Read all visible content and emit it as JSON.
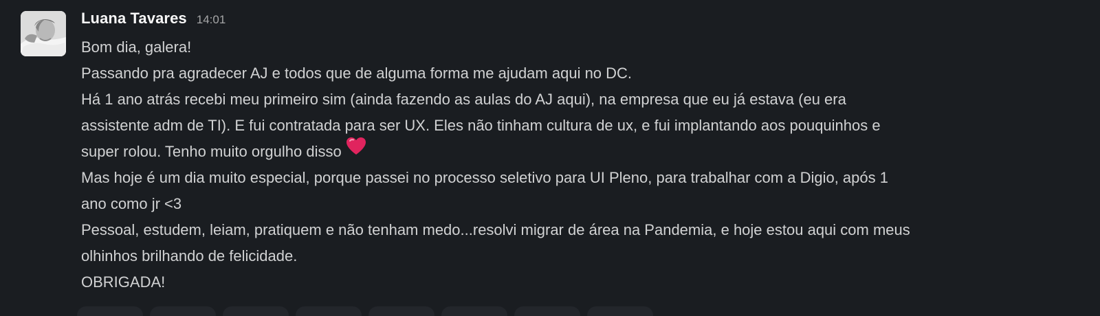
{
  "message": {
    "author": "Luana Tavares",
    "timestamp": "14:01",
    "avatar_icon": "user-avatar-photo",
    "lines": {
      "l1": "Bom dia, galera!",
      "l2": "Passando pra agradecer AJ e todos que de alguma forma me ajudam aqui no DC.",
      "l3": "Há 1 ano atrás recebi meu primeiro sim (ainda fazendo as aulas do AJ aqui), na empresa que eu já estava (eu era",
      "l4": "assistente adm de TI). E fui contratada para ser UX. Eles não tinham cultura de ux, e fui implantando aos pouquinhos e",
      "l5": "super rolou. Tenho muito orgulho disso",
      "l6": "Mas hoje é um dia muito especial, porque passei no processo seletivo para UI Pleno, para trabalhar com a Digio, após 1",
      "l7": "ano como jr <3",
      "l8": "Pessoal, estudem, leiam, pratiquem e não tenham medo...resolvi migrar de área na Pandemia, e hoje estou aqui com meus",
      "l9": "olhinhos brilhando de felicidade.",
      "l10": "OBRIGADA!"
    },
    "emoji": "heart-emoji"
  },
  "colors": {
    "background": "#1a1d21",
    "author": "#f8f8f8",
    "text": "#d1d2d3",
    "timestamp": "#a5a6a7",
    "heart": "#e0245e"
  }
}
